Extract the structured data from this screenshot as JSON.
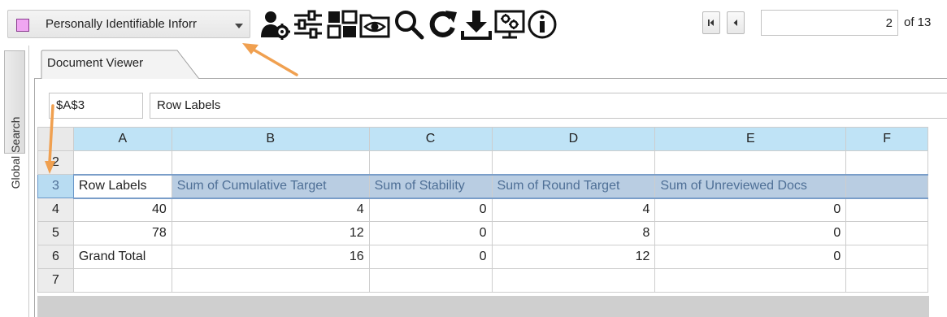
{
  "toolbar": {
    "profile": {
      "selected": "Personally Identifiable Inforr",
      "swatch_color": "#f0a6f2"
    },
    "icons": [
      "person-gear-icon",
      "sliders-icon",
      "layout-grid-icon",
      "preview-eye-icon",
      "search-icon",
      "refresh-icon",
      "download-icon",
      "monitor-gears-icon",
      "info-icon"
    ],
    "pager": {
      "current_page": "2",
      "total_label": "of 13"
    }
  },
  "sidebar": {
    "global_search_label": "Global Search"
  },
  "viewer": {
    "tab_label": "Document Viewer",
    "formula_bar": {
      "cell_ref": "$A$3",
      "content": "Row Labels"
    },
    "grid": {
      "columns": [
        "A",
        "B",
        "C",
        "D",
        "E",
        "F"
      ],
      "rows": [
        {
          "num": "2",
          "cells": [
            "",
            "",
            "",
            "",
            "",
            ""
          ]
        },
        {
          "num": "3",
          "cells": [
            "Row Labels",
            "Sum of Cumulative Target",
            "Sum of Stability",
            "Sum of Round Target",
            "Sum of Unreviewed Docs",
            ""
          ]
        },
        {
          "num": "4",
          "cells": [
            "40",
            "4",
            "0",
            "4",
            "0",
            ""
          ]
        },
        {
          "num": "5",
          "cells": [
            "78",
            "12",
            "0",
            "8",
            "0",
            ""
          ]
        },
        {
          "num": "6",
          "cells": [
            "Grand Total",
            "16",
            "0",
            "12",
            "0",
            ""
          ]
        },
        {
          "num": "7",
          "cells": [
            "",
            "",
            "",
            "",
            "",
            ""
          ]
        }
      ]
    }
  },
  "colors": {
    "accent_arrow": "#f0a050",
    "header_fill": "#bfe3f6",
    "selected_row_fill": "#b9cde2"
  }
}
